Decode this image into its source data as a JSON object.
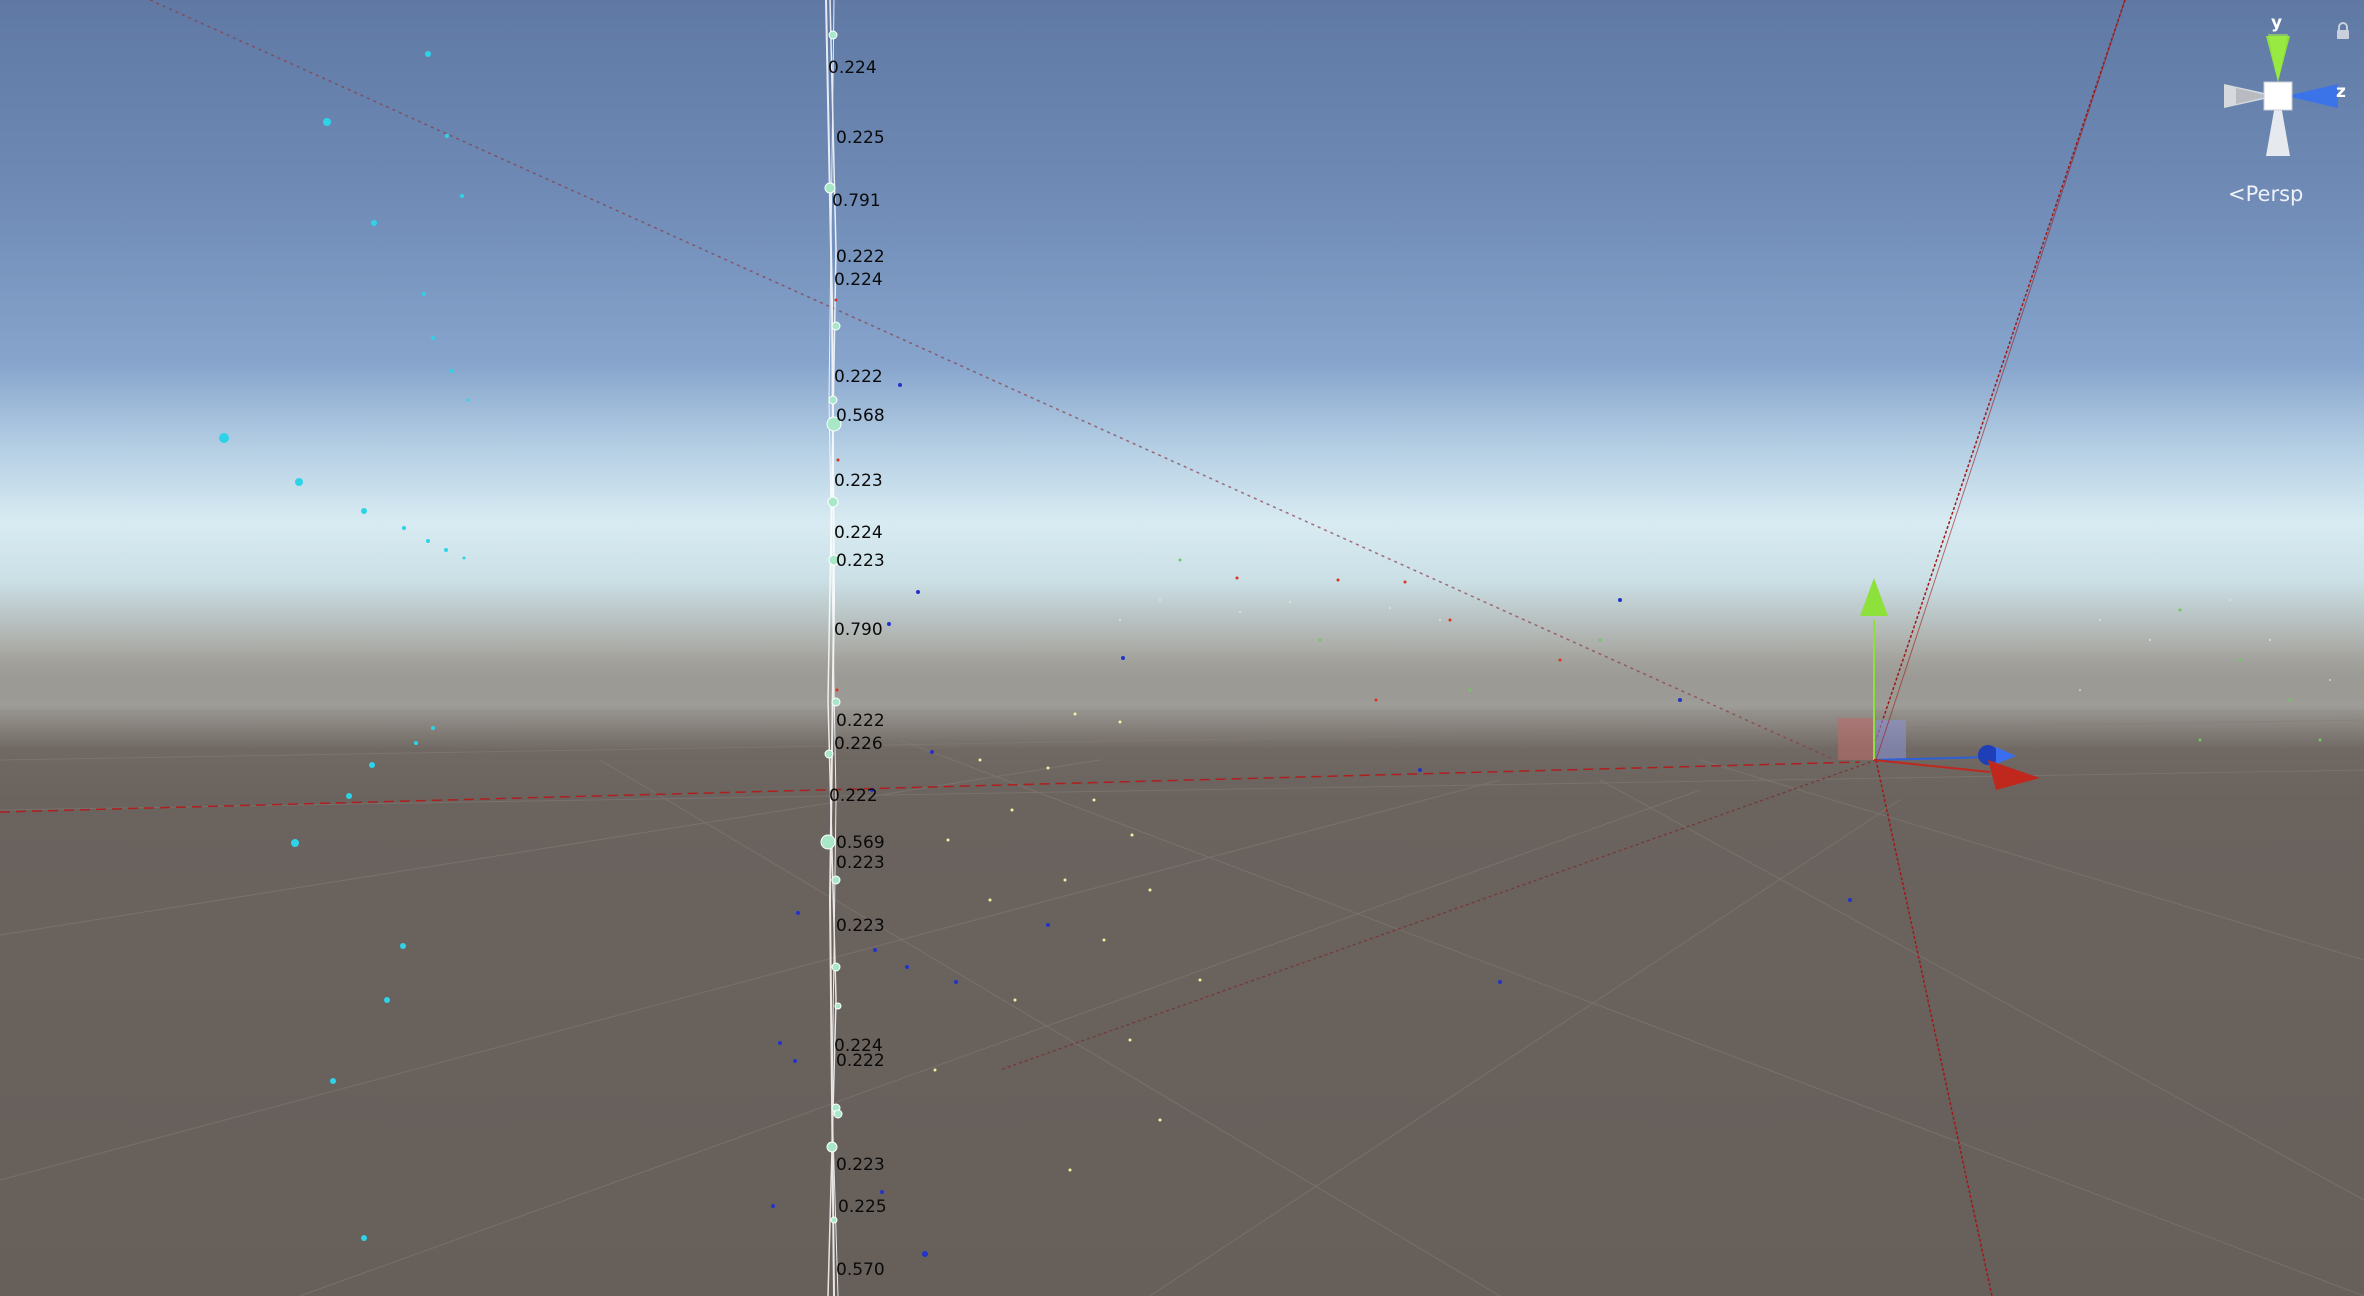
{
  "scene": {
    "camera_mode": "Persp",
    "gizmo_axes": {
      "y": "y",
      "z": "z"
    },
    "colors": {
      "sky_top": "#5f79a4",
      "horizon": "#d8ebf2",
      "ground": "#675f5a",
      "point_cyan": "#2fd3e8",
      "line_white": "#ffffff",
      "axis_red": "#c0281e",
      "axis_green": "#8ee03a",
      "axis_blue": "#2c5fd8"
    },
    "icons": {
      "lock": "lock-icon",
      "orientation": "orientation-gizmo-icon",
      "move_tool": "move-tool-gizmo-icon"
    }
  },
  "value_labels": [
    "0.224",
    "0.225",
    "0.791",
    "0.222",
    "0.224",
    "0.222",
    "0.568",
    "0.223",
    "0.224",
    "0.223",
    "0.790",
    "0.222",
    "0.226",
    "0.222",
    "0.569",
    "0.223",
    "0.223",
    "0.224",
    "0.222",
    "0.223",
    "0.225",
    "0.570"
  ]
}
